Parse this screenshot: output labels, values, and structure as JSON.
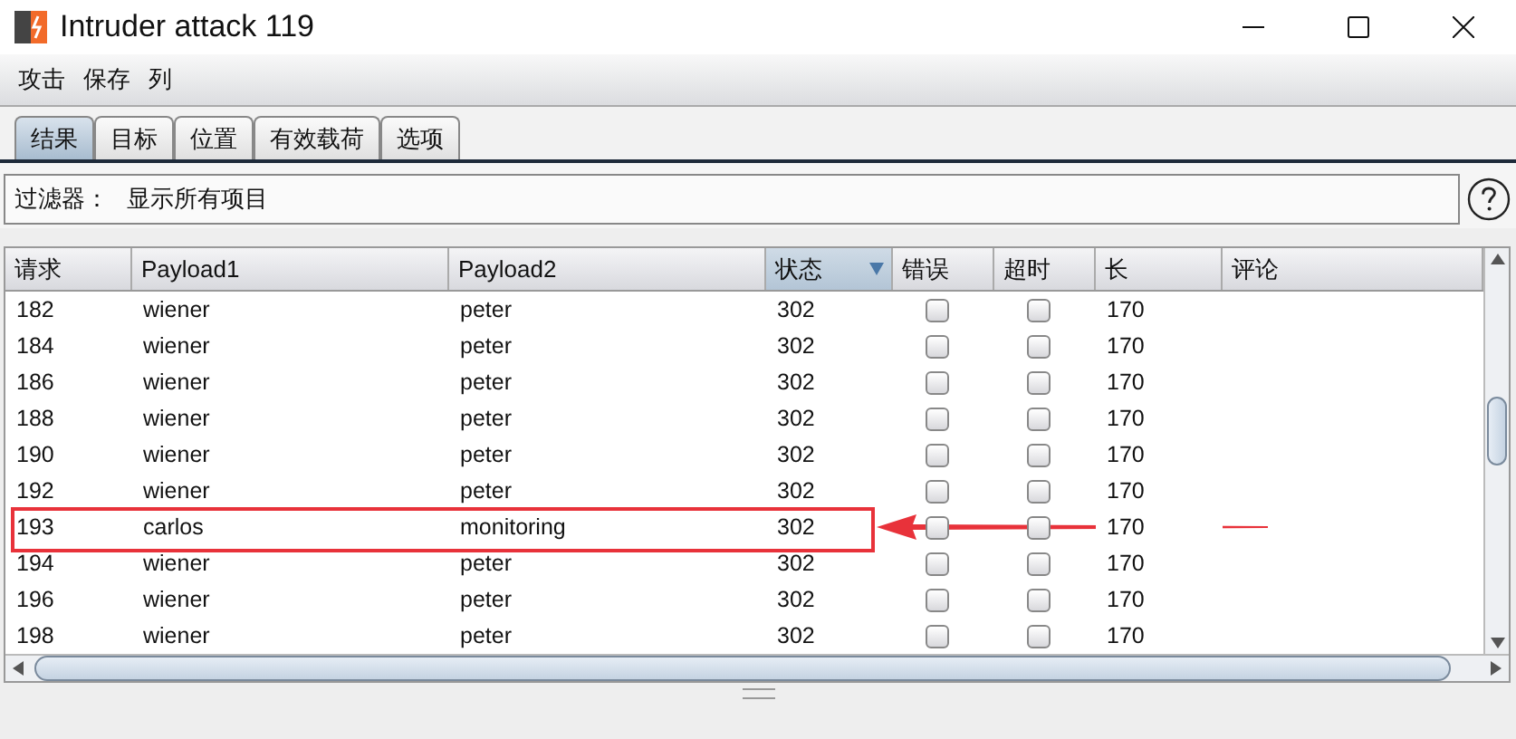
{
  "window": {
    "title": "Intruder attack 119"
  },
  "menu": [
    "攻击",
    "保存",
    "列"
  ],
  "tabs": [
    {
      "label": "结果",
      "selected": true
    },
    {
      "label": "目标",
      "selected": false
    },
    {
      "label": "位置",
      "selected": false
    },
    {
      "label": "有效载荷",
      "selected": false
    },
    {
      "label": "选项",
      "selected": false
    }
  ],
  "filter": {
    "label": "过滤器：",
    "value": "显示所有项目"
  },
  "table": {
    "columns": [
      {
        "label": "请求",
        "sorted": false
      },
      {
        "label": "Payload1",
        "sorted": false
      },
      {
        "label": "Payload2",
        "sorted": false
      },
      {
        "label": "状态",
        "sorted": true
      },
      {
        "label": "错误",
        "sorted": false
      },
      {
        "label": "超时",
        "sorted": false
      },
      {
        "label": "长",
        "sorted": false
      },
      {
        "label": "评论",
        "sorted": false
      }
    ],
    "rows": [
      {
        "request": "182",
        "payload1": "wiener",
        "payload2": "peter",
        "status": "302",
        "error": false,
        "timeout": false,
        "length": "170",
        "highlighted": false
      },
      {
        "request": "184",
        "payload1": "wiener",
        "payload2": "peter",
        "status": "302",
        "error": false,
        "timeout": false,
        "length": "170",
        "highlighted": false
      },
      {
        "request": "186",
        "payload1": "wiener",
        "payload2": "peter",
        "status": "302",
        "error": false,
        "timeout": false,
        "length": "170",
        "highlighted": false
      },
      {
        "request": "188",
        "payload1": "wiener",
        "payload2": "peter",
        "status": "302",
        "error": false,
        "timeout": false,
        "length": "170",
        "highlighted": false
      },
      {
        "request": "190",
        "payload1": "wiener",
        "payload2": "peter",
        "status": "302",
        "error": false,
        "timeout": false,
        "length": "170",
        "highlighted": false
      },
      {
        "request": "192",
        "payload1": "wiener",
        "payload2": "peter",
        "status": "302",
        "error": false,
        "timeout": false,
        "length": "170",
        "highlighted": false
      },
      {
        "request": "193",
        "payload1": "carlos",
        "payload2": "monitoring",
        "status": "302",
        "error": false,
        "timeout": false,
        "length": "170",
        "highlighted": true
      },
      {
        "request": "194",
        "payload1": "wiener",
        "payload2": "peter",
        "status": "302",
        "error": false,
        "timeout": false,
        "length": "170",
        "highlighted": false
      },
      {
        "request": "196",
        "payload1": "wiener",
        "payload2": "peter",
        "status": "302",
        "error": false,
        "timeout": false,
        "length": "170",
        "highlighted": false
      },
      {
        "request": "198",
        "payload1": "wiener",
        "payload2": "peter",
        "status": "302",
        "error": false,
        "timeout": false,
        "length": "170",
        "highlighted": false
      }
    ]
  }
}
